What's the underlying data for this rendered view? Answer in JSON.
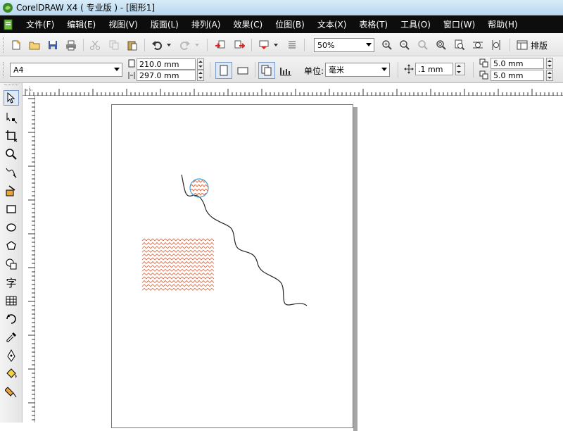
{
  "window": {
    "title": "CorelDRAW X4 ( 专业版 ) - [图形1]"
  },
  "menu": [
    {
      "label": "文件(F)"
    },
    {
      "label": "编辑(E)"
    },
    {
      "label": "视图(V)"
    },
    {
      "label": "版面(L)"
    },
    {
      "label": "排列(A)"
    },
    {
      "label": "效果(C)"
    },
    {
      "label": "位图(B)"
    },
    {
      "label": "文本(X)"
    },
    {
      "label": "表格(T)"
    },
    {
      "label": "工具(O)"
    },
    {
      "label": "窗口(W)"
    },
    {
      "label": "帮助(H)"
    }
  ],
  "standard_toolbar": {
    "zoom_value": "50%",
    "layout_label": "排版"
  },
  "property_bar": {
    "page_size": "A4",
    "page_width": "210.0 mm",
    "page_height": "297.0 mm",
    "units_label": "单位:",
    "units_value": "毫米",
    "nudge_value": ".1 mm",
    "dup_x": "5.0 mm",
    "dup_y": "5.0 mm"
  },
  "toolbox": {
    "text_tool_glyph": "字"
  },
  "colors": {
    "menubar_bg": "#0d0d0d",
    "pattern_stroke": "#e0704a",
    "circle_outline": "#3ea0d8",
    "curve_stroke": "#222222"
  },
  "ruler": {
    "corner_icon": "crosshair-icon"
  }
}
